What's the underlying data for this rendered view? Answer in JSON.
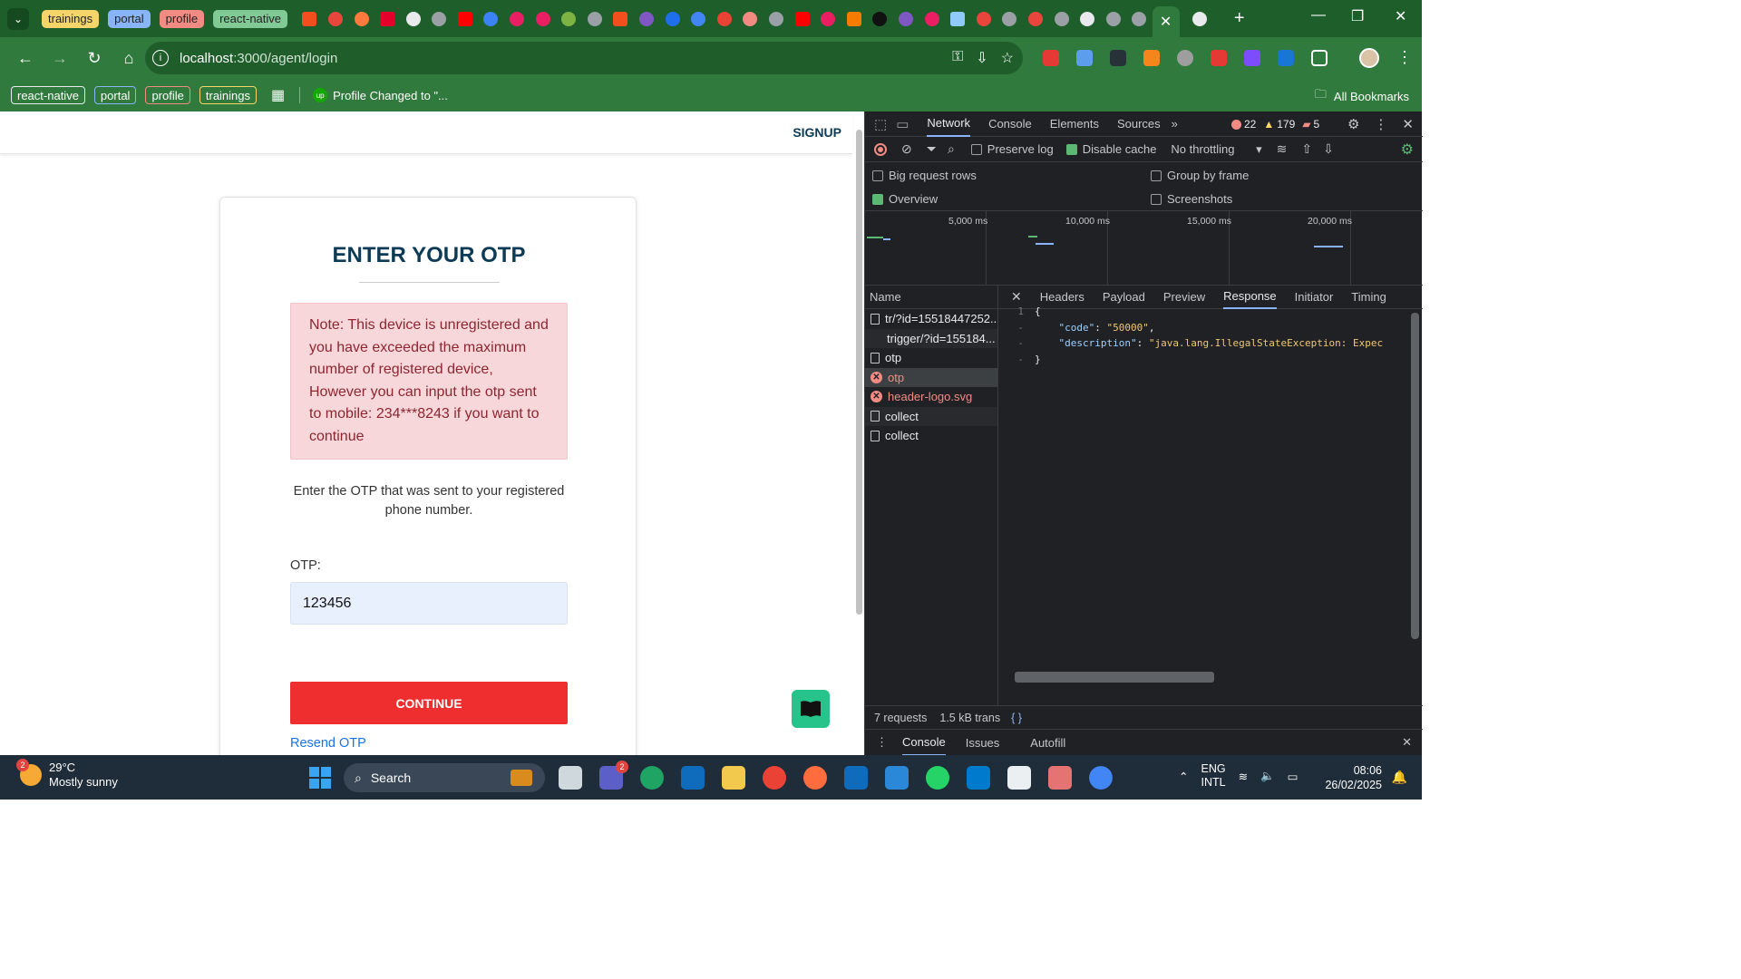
{
  "browser": {
    "tab_groups": [
      {
        "label": "trainings",
        "color": "#f5d56a"
      },
      {
        "label": "portal",
        "color": "#8ab4f8"
      },
      {
        "label": "profile",
        "color": "#f28b82"
      },
      {
        "label": "react-native",
        "color": "#81c995"
      }
    ],
    "address": {
      "host": "localhost",
      "path": ":3000/agent/login"
    },
    "bookmarks": [
      {
        "label": "react-native",
        "color": "#e8eaed"
      },
      {
        "label": "portal",
        "color": "#8ab4f8"
      },
      {
        "label": "profile",
        "color": "#f28b82"
      },
      {
        "label": "trainings",
        "color": "#f5d56a"
      }
    ],
    "bookmark_item": "Profile Changed to \"...",
    "bookmark_item_icon": "up",
    "all_bookmarks": "All Bookmarks"
  },
  "page": {
    "signup": "SIGNUP",
    "title": "ENTER YOUR OTP",
    "note": "Note: This device is unregistered and you have exceeded the maximum number of registered device, However you can input the otp sent to mobile: 234***8243 if you want to continue",
    "hint": "Enter the OTP that was sent to your registered phone number.",
    "otp_label": "OTP:",
    "otp_value": "123456",
    "resend": "Resend OTP",
    "continue": "CONTINUE"
  },
  "devtools": {
    "tabs": [
      "Network",
      "Console",
      "Elements",
      "Sources"
    ],
    "errors": "22",
    "warnings": "179",
    "issues": "5",
    "preserve_log": "Preserve log",
    "disable_cache": "Disable cache",
    "throttling": "No throttling",
    "opts": {
      "big_rows": "Big request rows",
      "group_frame": "Group by frame",
      "overview": "Overview",
      "screenshots": "Screenshots"
    },
    "overview_ticks": [
      "5,000 ms",
      "10,000 ms",
      "15,000 ms",
      "20,000 ms"
    ],
    "name_header": "Name",
    "requests": [
      {
        "name": "tr/?id=15518447252...",
        "status": "file"
      },
      {
        "name": "trigger/?id=155184...",
        "status": "none"
      },
      {
        "name": "otp",
        "status": "file"
      },
      {
        "name": "otp",
        "status": "error"
      },
      {
        "name": "header-logo.svg",
        "status": "error"
      },
      {
        "name": "collect",
        "status": "file"
      },
      {
        "name": "collect",
        "status": "file"
      }
    ],
    "detail_tabs": [
      "Headers",
      "Payload",
      "Preview",
      "Response",
      "Initiator",
      "Timing"
    ],
    "response": {
      "line_number": "1",
      "open": "{",
      "code_key": "\"code\"",
      "code_val": "\"50000\"",
      "desc_key": "\"description\"",
      "desc_val": "\"java.lang.IllegalStateException: Expec",
      "close": "}"
    },
    "status_requests": "7 requests",
    "status_transfer": "1.5 kB trans",
    "drawer_tabs": [
      "Console",
      "Issues",
      "Autofill"
    ]
  },
  "taskbar": {
    "weather_temp": "29°C",
    "weather_desc": "Mostly sunny",
    "weather_badge": "2",
    "search": "Search",
    "teams_badge": "2",
    "lang_top": "ENG",
    "lang_bottom": "INTL",
    "time": "08:06",
    "date": "26/02/2025"
  }
}
